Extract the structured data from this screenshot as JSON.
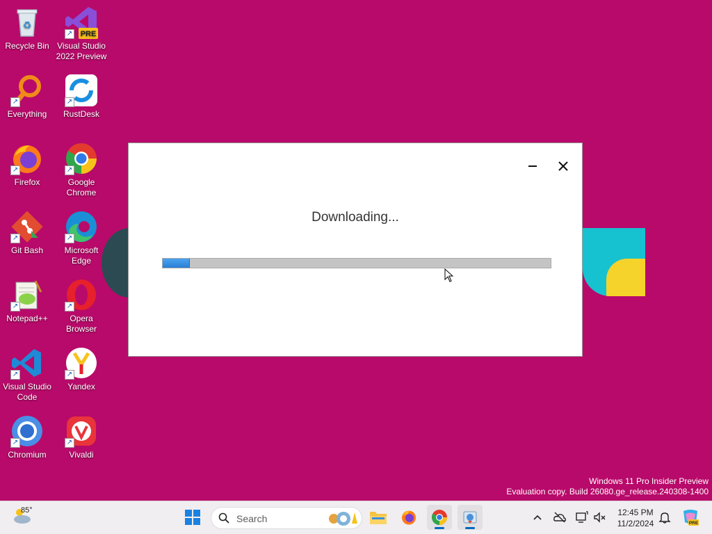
{
  "desktop": {
    "icons": [
      {
        "label": "Recycle Bin"
      },
      {
        "label": "Visual Studio 2022 Preview",
        "badge": "PRE"
      },
      {
        "label": "Everything"
      },
      {
        "label": "RustDesk"
      },
      {
        "label": "Firefox"
      },
      {
        "label": "Google Chrome"
      },
      {
        "label": "Git Bash"
      },
      {
        "label": "Microsoft Edge"
      },
      {
        "label": "Notepad++"
      },
      {
        "label": "Opera Browser"
      },
      {
        "label": "Visual Studio Code"
      },
      {
        "label": "Yandex"
      },
      {
        "label": "Chromium"
      },
      {
        "label": "Vivaldi"
      }
    ],
    "wallpaper_color": "#b80a6a"
  },
  "dialog": {
    "status_text": "Downloading...",
    "progress_fraction": 0.07
  },
  "watermark": {
    "line1": "Windows 11 Pro Insider Preview",
    "line2": "Evaluation copy. Build 26080.ge_release.240308-1400"
  },
  "taskbar": {
    "weather_temp": "85°",
    "search_placeholder": "Search",
    "clock_time": "12:45 PM",
    "clock_date": "11/2/2024",
    "accent_color": "#0067c0"
  }
}
